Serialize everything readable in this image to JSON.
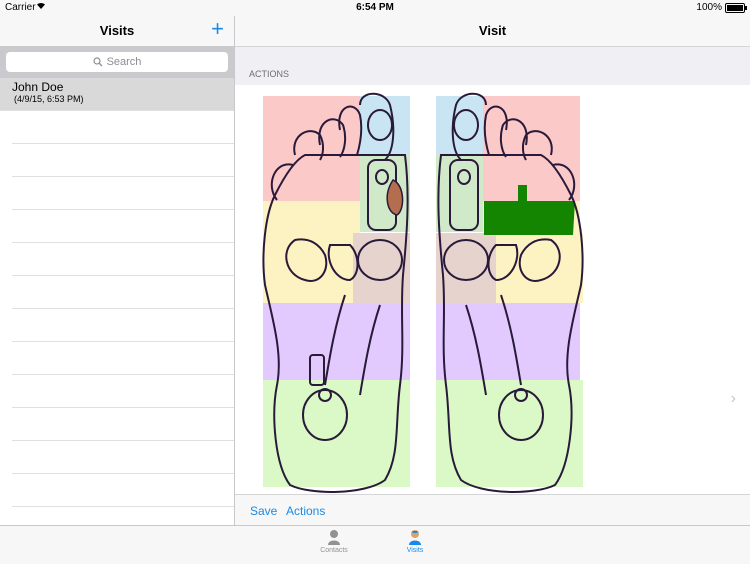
{
  "status": {
    "carrier": "Carrier",
    "time": "6:54 PM",
    "battery": "100%"
  },
  "master": {
    "title": "Visits",
    "add_label": "+",
    "search_placeholder": "Search",
    "visits": [
      {
        "name": "John Doe",
        "date": "(4/9/15, 6:53 PM)"
      }
    ]
  },
  "detail": {
    "title": "Visit",
    "section": "ACTIONS",
    "toolbar": {
      "save": "Save",
      "actions": "Actions"
    }
  },
  "tabs": [
    {
      "label": "Contacts"
    },
    {
      "label": "Visits"
    }
  ],
  "colors": {
    "accent": "#1a8ae6",
    "selected_row": "#d9d9d9",
    "toe_zone": "#fcc9c9",
    "upper_zone": "#fdf2c2",
    "middle_zone": "#e6d3ce",
    "arch_zone": "#e2caff",
    "heel_zone": "#dbf9c6",
    "spine_zone": "#c9e5f4",
    "active_zone": "#138500"
  }
}
